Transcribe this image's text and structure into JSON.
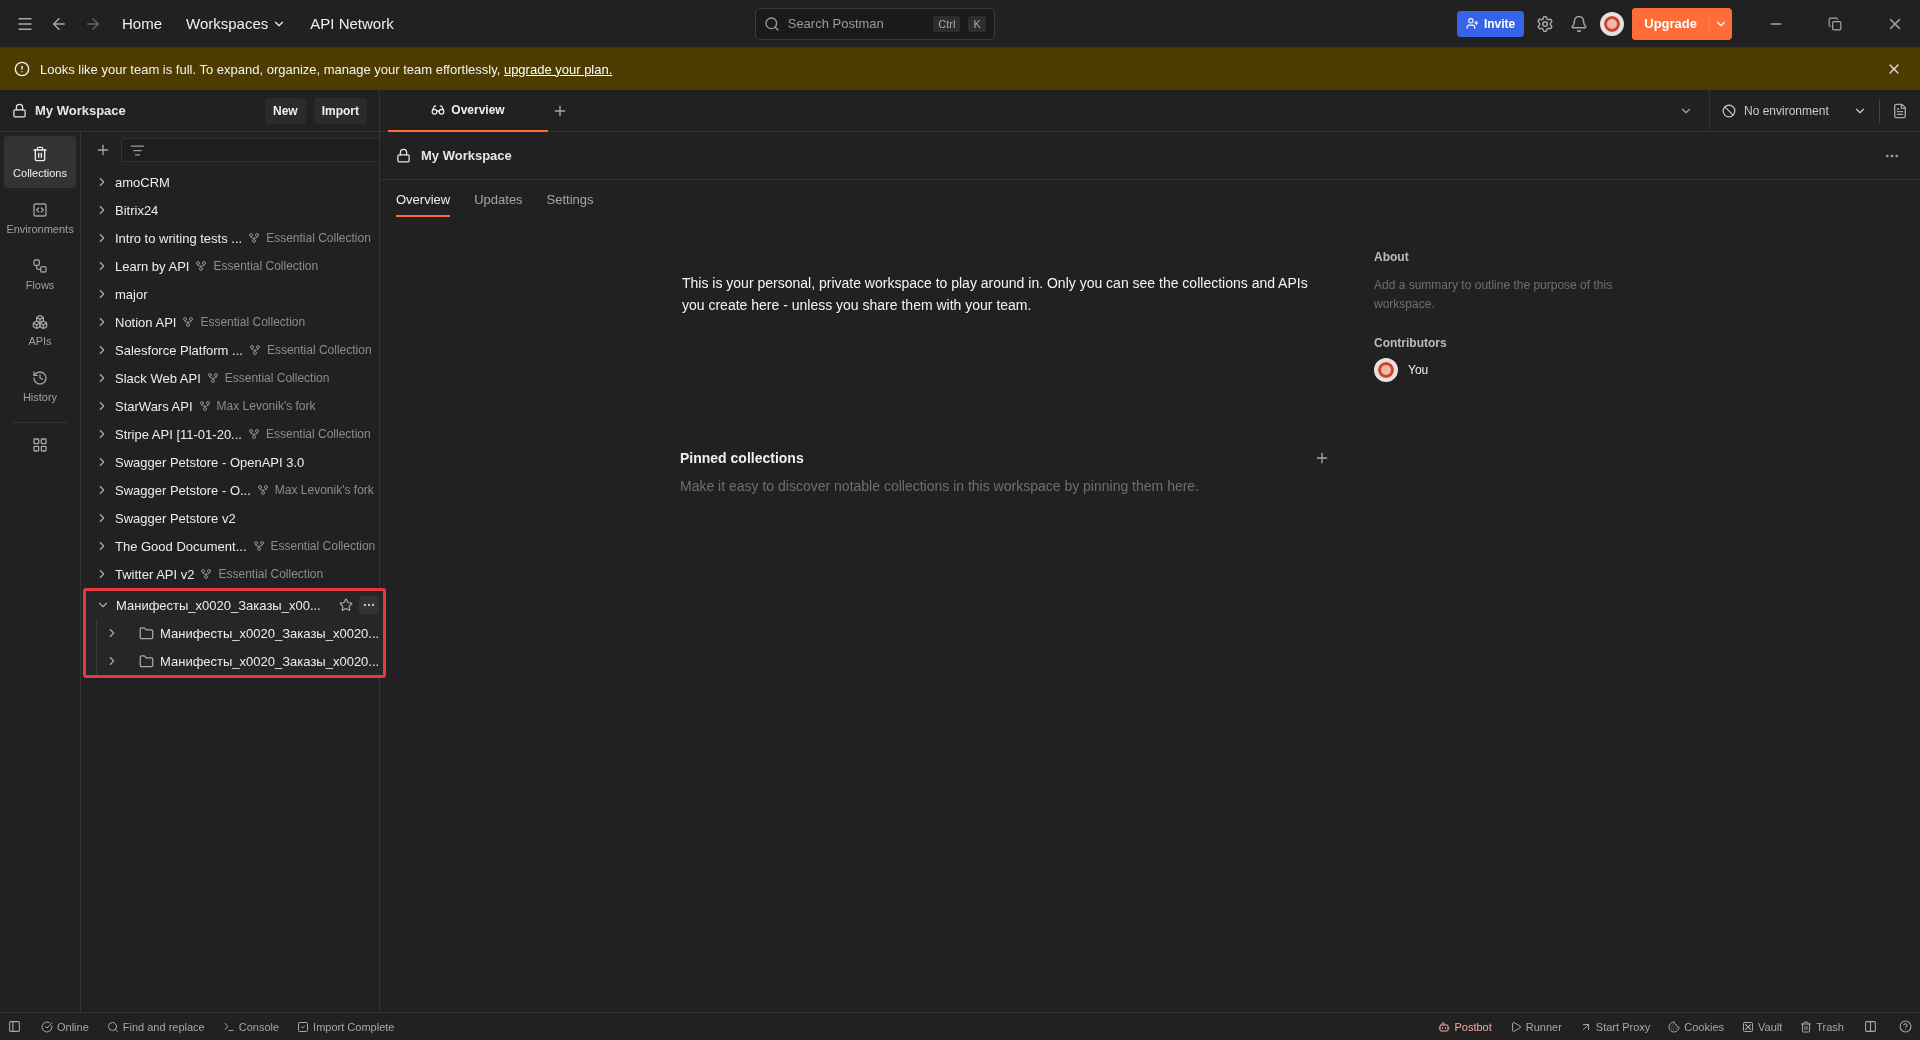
{
  "top_bar": {
    "nav": [
      {
        "label": "Home",
        "dropdown": false
      },
      {
        "label": "Workspaces",
        "dropdown": true
      },
      {
        "label": "API Network",
        "dropdown": false
      }
    ],
    "search": {
      "placeholder": "Search Postman",
      "keys": [
        "Ctrl",
        "K"
      ]
    },
    "invite": "Invite",
    "upgrade": "Upgrade"
  },
  "banner": {
    "text": "Looks like your team is full. To expand, organize, manage your team effortlessly, ",
    "link": "upgrade your plan."
  },
  "sidebar": {
    "workspace": "My Workspace",
    "buttons": [
      "New",
      "Import"
    ],
    "rail": [
      {
        "label": "Collections",
        "selected": true
      },
      {
        "label": "Environments",
        "selected": false
      },
      {
        "label": "Flows",
        "selected": false
      },
      {
        "label": "APIs",
        "selected": false
      },
      {
        "label": "History",
        "selected": false
      }
    ],
    "collections": [
      {
        "name": "amoCRM",
        "expanded": false,
        "highlighted": false
      },
      {
        "name": "Bitrix24",
        "expanded": false,
        "highlighted": false
      },
      {
        "name": "Intro to writing tests ...",
        "fork": "Essential Collection",
        "expanded": false,
        "highlighted": false
      },
      {
        "name": "Learn by API",
        "fork": "Essential Collection",
        "expanded": false,
        "highlighted": false
      },
      {
        "name": "major",
        "expanded": false,
        "highlighted": false
      },
      {
        "name": "Notion API",
        "fork": "Essential Collection",
        "expanded": false,
        "highlighted": false
      },
      {
        "name": "Salesforce Platform ...",
        "fork": "Essential Collection",
        "expanded": false,
        "highlighted": false
      },
      {
        "name": "Slack Web API",
        "fork": "Essential Collection",
        "expanded": false,
        "highlighted": false
      },
      {
        "name": "StarWars API",
        "fork": "Max Levonik's fork",
        "expanded": false,
        "highlighted": false
      },
      {
        "name": "Stripe API [11-01-20...",
        "fork": "Essential Collection",
        "expanded": false,
        "highlighted": false
      },
      {
        "name": "Swagger Petstore - OpenAPI 3.0",
        "expanded": false,
        "highlighted": false
      },
      {
        "name": "Swagger Petstore - O...",
        "fork": "Max Levonik's fork",
        "expanded": false,
        "highlighted": false
      },
      {
        "name": "Swagger Petstore v2",
        "expanded": false,
        "highlighted": false
      },
      {
        "name": "The Good Document...",
        "fork": "Essential Collection",
        "expanded": false,
        "highlighted": false
      },
      {
        "name": "Twitter API v2",
        "fork": "Essential Collection",
        "expanded": false,
        "highlighted": false
      },
      {
        "name": "Манифесты_x0020_Заказы_x00...",
        "expanded": true,
        "highlighted": true,
        "children": [
          {
            "name": "Манифесты_x0020_Заказы_x0020...",
            "expanded": false
          },
          {
            "name": "Манифесты_x0020_Заказы_x0020...",
            "expanded": false
          }
        ]
      }
    ]
  },
  "main": {
    "tabs": [
      {
        "label": "Overview",
        "selected": true
      }
    ],
    "environment": "No environment",
    "title": "My Workspace",
    "subtabs": [
      {
        "label": "Overview",
        "selected": true
      },
      {
        "label": "Updates",
        "selected": false
      },
      {
        "label": "Settings",
        "selected": false
      }
    ],
    "description": "This is your personal, private workspace to play around in. Only you can see the collections and APIs you create here - unless you share them with your team.",
    "about": {
      "heading": "About",
      "placeholder": "Add a summary to outline the purpose of this workspace."
    },
    "contributors": {
      "heading": "Contributors",
      "people": [
        "You"
      ]
    },
    "pinned": {
      "heading": "Pinned collections",
      "hint": "Make it easy to discover notable collections in this workspace by pinning them here."
    }
  },
  "status_bar": {
    "left": [
      {
        "label": "Online",
        "active": false
      },
      {
        "label": "Find and replace",
        "active": false
      },
      {
        "label": "Console",
        "active": false
      },
      {
        "label": "Import Complete",
        "active": false
      }
    ],
    "right": [
      {
        "label": "Postbot",
        "active": true
      },
      {
        "label": "Runner",
        "active": false
      },
      {
        "label": "Start Proxy",
        "active": false
      },
      {
        "label": "Cookies",
        "active": false
      },
      {
        "label": "Vault",
        "active": false
      },
      {
        "label": "Trash",
        "active": false
      }
    ]
  }
}
